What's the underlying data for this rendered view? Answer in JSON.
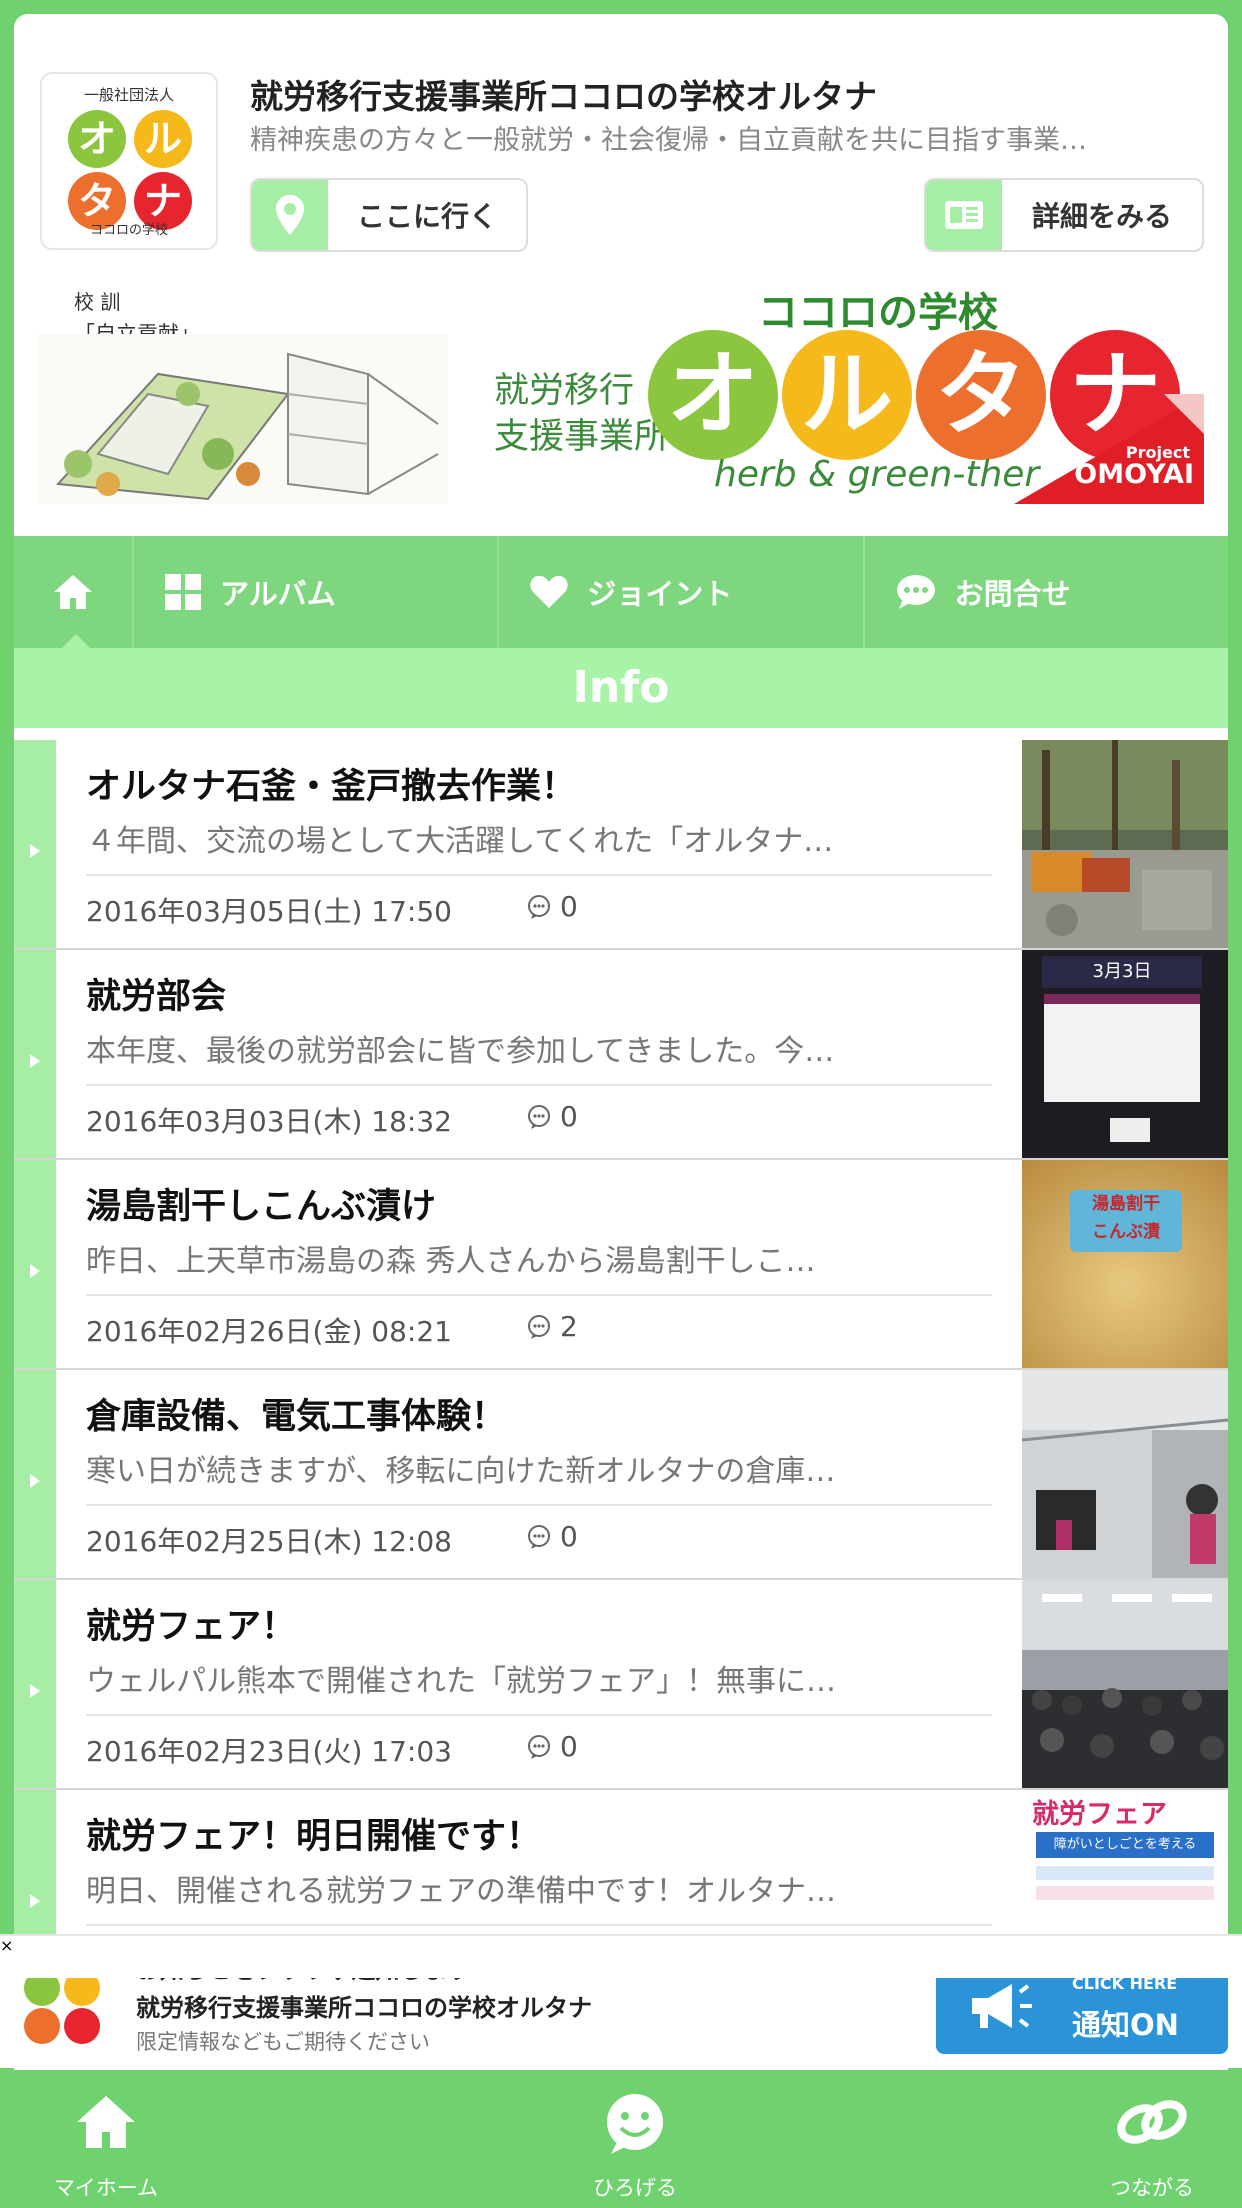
{
  "header": {
    "logo": {
      "top_text": "一般社団法人",
      "chars": [
        "オ",
        "ル",
        "タ",
        "ナ"
      ],
      "bottom_text": "ココロの学校"
    },
    "title": "就労移行支援事業所ココロの学校オルタナ",
    "description": "精神疾患の方々と一般就労・社会復帰・自立貢献を共に目指す事業…",
    "goto_label": "ここに行く",
    "detail_label": "詳細をみる"
  },
  "banner": {
    "motto_label": "校 訓",
    "motto": "「自立貢献」",
    "school": "ココロの学校",
    "vertical_1": "就労移行",
    "vertical_2": "支援事業所",
    "chars": [
      "オ",
      "ル",
      "タ",
      "ナ"
    ],
    "herb": "herb & green-ther",
    "project": "Project",
    "omoyai": "OMOYAI"
  },
  "tabs": [
    {
      "label": "アルバム",
      "icon": "grid-icon"
    },
    {
      "label": "ジョイント",
      "icon": "heart-icon"
    },
    {
      "label": "お問合せ",
      "icon": "chat-bubble-icon"
    }
  ],
  "section_title": "Info",
  "posts": [
    {
      "title": "オルタナ石釜・釜戸撤去作業！",
      "excerpt": "４年間、交流の場として大活躍してくれた「オルタナ…",
      "date": "2016年03月05日(土) 17:50",
      "comments": "0"
    },
    {
      "title": "就労部会",
      "excerpt": "本年度、最後の就労部会に皆で参加してきました。今…",
      "date": "2016年03月03日(木) 18:32",
      "comments": "0"
    },
    {
      "title": "湯島割干しこんぶ漬け",
      "excerpt": "昨日、上天草市湯島の森 秀人さんから湯島割干しこ…",
      "date": "2016年02月26日(金) 08:21",
      "comments": "2"
    },
    {
      "title": "倉庫設備、電気工事体験！",
      "excerpt": "寒い日が続きますが、移転に向けた新オルタナの倉庫…",
      "date": "2016年02月25日(木) 12:08",
      "comments": "0"
    },
    {
      "title": "就労フェア！",
      "excerpt": "ウェルパル熊本で開催された「就労フェア」！無事に…",
      "date": "2016年02月23日(火) 17:03",
      "comments": "0"
    },
    {
      "title": "就労フェア！明日開催です！",
      "excerpt": "明日、開催される就労フェアの準備中です！オルタナ…",
      "date": "",
      "comments": ""
    }
  ],
  "thumb_text": {
    "t2": "3月3日",
    "t3": "湯島割干\nこんぶ漬",
    "t6_a": "就労フェア",
    "t6_b": "障がいとしごとを考える"
  },
  "push": {
    "line1": "お知らせをブラウザ通知します",
    "line2": "就労移行支援事業所ココロの学校オルタナ",
    "line3": "限定情報などもご期待ください",
    "cta_small": "CLICK HERE",
    "cta_big": "通知ON",
    "close": "×"
  },
  "bottom_nav": [
    {
      "label": "マイホーム",
      "icon": "home-icon"
    },
    {
      "label": "ひろげる",
      "icon": "smile-icon"
    },
    {
      "label": "つながる",
      "icon": "link-icon"
    }
  ],
  "colors": {
    "accent_green": "#6fd26f",
    "light_green": "#a8f3a8",
    "logo_green": "#8cc63f",
    "logo_yellow": "#f5b91b",
    "logo_orange": "#ec6f2d",
    "logo_red": "#e6252e",
    "cta_blue": "#2b93d8"
  }
}
